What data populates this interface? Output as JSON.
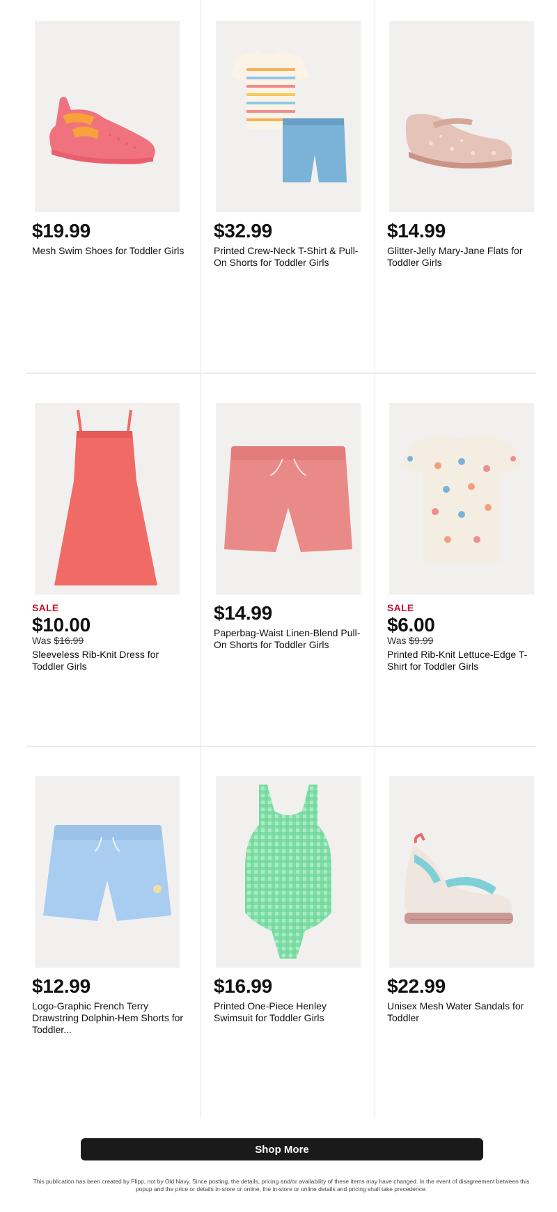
{
  "products": [
    {
      "price": "$19.99",
      "sale": "",
      "was_label": "",
      "was_price": "",
      "name": "Mesh Swim Shoes for Toddler Girls",
      "image": "pink-mesh-swim-shoe",
      "colors": [
        "#f0727f",
        "#f7a23b"
      ]
    },
    {
      "price": "$32.99",
      "sale": "",
      "was_label": "",
      "was_price": "",
      "name": "Printed Crew-Neck T-Shirt & Pull-On Shorts for Toddler Girls",
      "image": "striped-tee-and-chambray-shorts",
      "colors": [
        "#f6b25a",
        "#7ab2d8"
      ]
    },
    {
      "price": "$14.99",
      "sale": "",
      "was_label": "",
      "was_price": "",
      "name": "Glitter-Jelly Mary-Jane Flats for Toddler Girls",
      "image": "glitter-jelly-flat",
      "colors": [
        "#e2b9ad",
        "#f0d0c6"
      ]
    },
    {
      "price": "$10.00",
      "sale": "SALE",
      "was_label": "Was",
      "was_price": "$16.99",
      "name": "Sleeveless Rib-Knit Dress for Toddler Girls",
      "image": "coral-rib-knit-dress",
      "colors": [
        "#f06a66"
      ]
    },
    {
      "price": "$14.99",
      "sale": "",
      "was_label": "",
      "was_price": "",
      "name": "Paperbag-Waist Linen-Blend Pull-On Shorts for Toddler Girls",
      "image": "coral-linen-shorts",
      "colors": [
        "#ea8a88"
      ]
    },
    {
      "price": "$6.00",
      "sale": "SALE",
      "was_label": "Was",
      "was_price": "$9.99",
      "name": "Printed Rib-Knit Lettuce-Edge T-Shirt for Toddler Girls",
      "image": "floral-lettuce-edge-tee",
      "colors": [
        "#f4eee2"
      ]
    },
    {
      "price": "$12.99",
      "sale": "",
      "was_label": "",
      "was_price": "",
      "name": "Logo-Graphic French Terry Drawstring Dolphin-Hem Shorts for Toddler...",
      "image": "light-blue-terry-shorts",
      "colors": [
        "#a8cdf0"
      ]
    },
    {
      "price": "$16.99",
      "sale": "",
      "was_label": "",
      "was_price": "",
      "name": "Printed One-Piece Henley Swimsuit for Toddler Girls",
      "image": "green-gingham-swimsuit",
      "colors": [
        "#6fd79a"
      ]
    },
    {
      "price": "$22.99",
      "sale": "",
      "was_label": "",
      "was_price": "",
      "name": "Unisex Mesh Water Sandals for Toddler",
      "image": "mesh-water-sandal",
      "colors": [
        "#7fd0d6",
        "#c99a96"
      ]
    }
  ],
  "shop_more_label": "Shop More",
  "disclaimer": "This publication has been created by Flipp, not by Old Navy. Since posting, the details, pricing and/or availability of these items may have changed. In the event of disagreement between this popup and the price or details in-store or online, the in-store or online details and pricing shall take precedence.",
  "accent_colors": {
    "sale_red": "#c8102e",
    "button_bg": "#1a1a1a"
  }
}
